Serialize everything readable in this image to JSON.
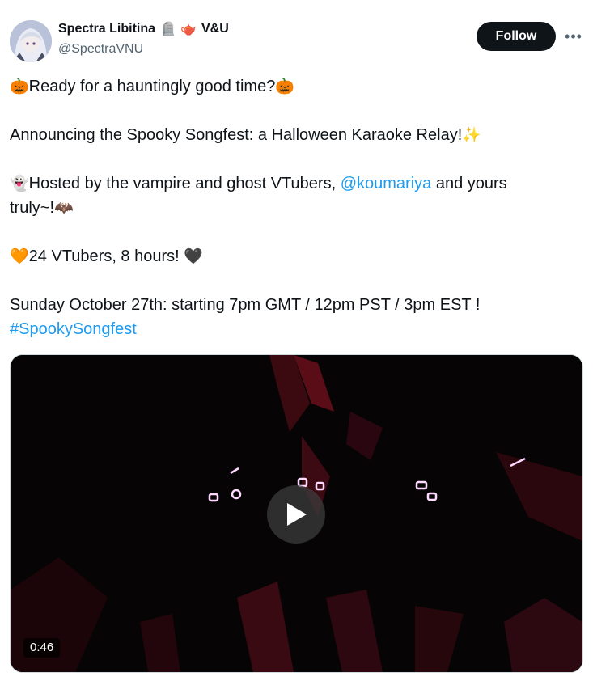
{
  "author": {
    "display_name": "Spectra Libitina",
    "name_emojis": "🪦 🫖",
    "name_suffix": "V&U",
    "handle": "@SpectraVNU",
    "avatar_icon": "avatar-image"
  },
  "actions": {
    "follow_label": "Follow",
    "more_icon": "more-horizontal-icon",
    "more_label": "•••"
  },
  "tweet": {
    "line1_emoji_start": "🎃",
    "line1_text": "Ready for a hauntingly good time?",
    "line1_emoji_end": "🎃",
    "line2_text": "Announcing the Spooky Songfest: a Halloween Karaoke Relay!",
    "line2_emoji": "✨",
    "line3_emoji": "👻",
    "line3_text_a": "Hosted by the vampire and ghost VTubers, ",
    "line3_mention": "@koumariya",
    "line3_text_b": " and yours",
    "line4_text": "truly~!",
    "line4_emoji": "🦇",
    "line5_emoji_start": "🧡",
    "line5_text": "24 VTubers, 8 hours! ",
    "line5_emoji_end": "🖤",
    "line6_text": "Sunday October 27th: starting 7pm GMT / 12pm PST / 3pm EST !",
    "hashtag": "#SpookySongfest"
  },
  "media": {
    "duration": "0:46",
    "play_icon": "play-icon"
  },
  "colors": {
    "text": "#0f1419",
    "secondary": "#536471",
    "link": "#1d9bf0",
    "follow_bg": "#0f1419"
  }
}
